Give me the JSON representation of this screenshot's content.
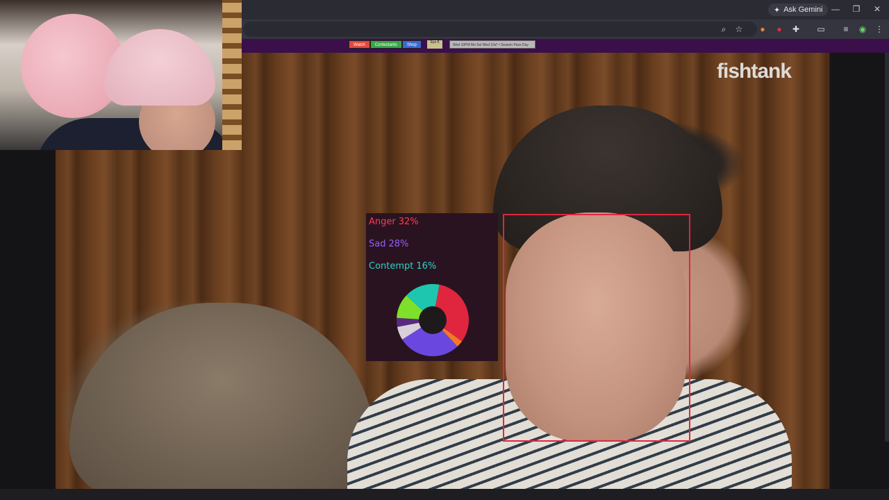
{
  "browser": {
    "ask_gemini": "Ask Gemini",
    "icons": [
      "zoom-icon",
      "star-icon",
      "extension-a-icon",
      "extension-b-icon",
      "puzzle-icon",
      "cast-icon",
      "media-icon",
      "profile-icon",
      "menu-icon"
    ]
  },
  "site": {
    "nav": [
      {
        "label": "Watch",
        "color": "#e04a3a"
      },
      {
        "label": "Contestants",
        "color": "#3aa64a"
      },
      {
        "label": "Shop",
        "color": "#3a6ad0"
      }
    ],
    "eps_label": "Eps 8",
    "now_playing": "Wed 10PM Mo 5a/ Wed 10a* • Season Pass Day",
    "watermark": "fishtank"
  },
  "emotion_overlay": {
    "labels": [
      {
        "name": "Anger",
        "value": "32%",
        "color": "#ff3a55"
      },
      {
        "name": "Sad",
        "value": "28%",
        "color": "#9a5cff"
      },
      {
        "name": "Contempt",
        "value": "16%",
        "color": "#2ad4c8"
      }
    ],
    "donut_segments": [
      {
        "share": 32,
        "color": "#e0253f"
      },
      {
        "share": 3,
        "color": "#f07a2a"
      },
      {
        "share": 28,
        "color": "#6a48e0"
      },
      {
        "share": 6,
        "color": "#d8d0d8"
      },
      {
        "share": 4,
        "color": "#5a2a80"
      },
      {
        "share": 11,
        "color": "#7ee02a"
      },
      {
        "share": 16,
        "color": "#1ec6b0"
      }
    ]
  },
  "colors": {
    "face_box": "#e0253f",
    "panel_bg": "#2a1320",
    "site_strip": "#3a0f4a"
  }
}
